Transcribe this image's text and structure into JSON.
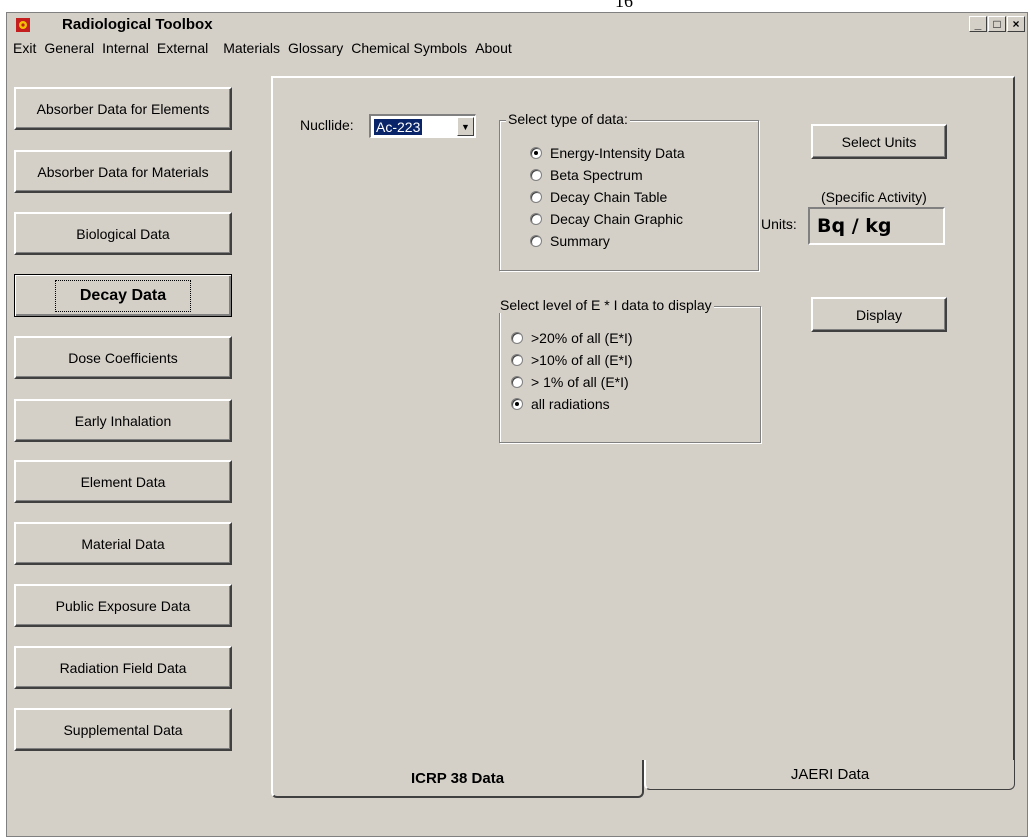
{
  "page_number": "16",
  "window": {
    "title": "Radiological Toolbox",
    "controls": {
      "minimize": "_",
      "maximize": "□",
      "close": "×"
    }
  },
  "menu": [
    "Exit",
    "General",
    "Internal",
    "External",
    "Materials",
    "Glossary",
    "Chemical Symbols",
    "About"
  ],
  "sidebar": [
    {
      "label": "Absorber Data for Elements"
    },
    {
      "label": "Absorber Data for Materials"
    },
    {
      "label": "Biological Data"
    },
    {
      "label": "Decay Data",
      "active": true
    },
    {
      "label": "Dose Coefficients"
    },
    {
      "label": "Early Inhalation"
    },
    {
      "label": "Element Data"
    },
    {
      "label": "Material Data"
    },
    {
      "label": "Public Exposure Data"
    },
    {
      "label": "Radiation Field Data"
    },
    {
      "label": "Supplemental Data"
    }
  ],
  "nuclide": {
    "label": "Nucllide:",
    "value": "Ac-223",
    "arrow": "▼"
  },
  "data_type": {
    "legend": "Select type of data:",
    "options": [
      {
        "label": "Energy-Intensity Data",
        "selected": true
      },
      {
        "label": "Beta Spectrum",
        "selected": false
      },
      {
        "label": "Decay Chain Table",
        "selected": false
      },
      {
        "label": "Decay Chain Graphic",
        "selected": false
      },
      {
        "label": "Summary",
        "selected": false
      }
    ]
  },
  "level": {
    "legend": "Select level of E * I data to display",
    "options": [
      {
        "label": ">20% of all (E*I)",
        "selected": false
      },
      {
        "label": ">10% of all (E*I)",
        "selected": false
      },
      {
        "label": "> 1% of all (E*I)",
        "selected": false
      },
      {
        "label": "all radiations",
        "selected": true
      }
    ]
  },
  "units": {
    "select_button": "Select Units",
    "caption": "(Specific Activity)",
    "label": "Units:",
    "value": "Bq / kg",
    "display_button": "Display"
  },
  "tabs": [
    {
      "label": "ICRP 38 Data",
      "active": true
    },
    {
      "label": "JAERI Data",
      "active": false
    }
  ]
}
